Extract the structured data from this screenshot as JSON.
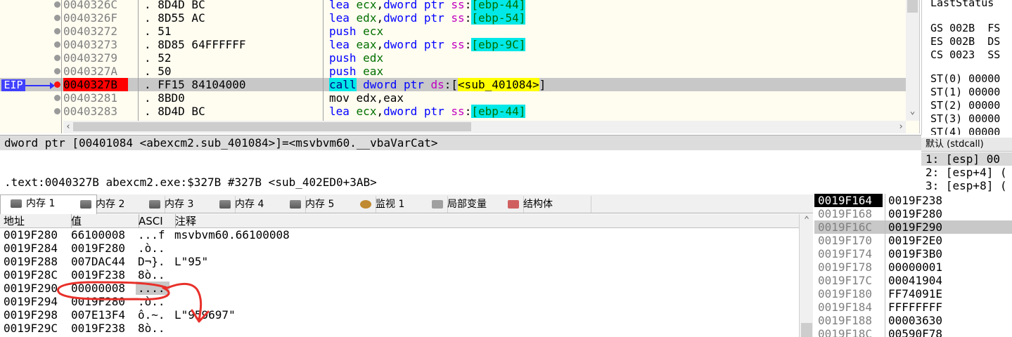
{
  "disasm": {
    "eip_label": "EIP",
    "rows": [
      {
        "addr": "0040326C",
        "bytes": ". 8D4D BC",
        "mn": "lea",
        "ops": [
          [
            "ecx",
            "k-green"
          ],
          [
            ",",
            ""
          ],
          [
            "dword ptr ",
            "k-blue"
          ],
          [
            "ss",
            "k-mag"
          ],
          [
            ":",
            "k-blk"
          ],
          [
            "[ebp-44]",
            "hl-cyan k-green"
          ]
        ]
      },
      {
        "addr": "0040326F",
        "bytes": ". 8D55 AC",
        "mn": "lea",
        "ops": [
          [
            "edx",
            "k-green"
          ],
          [
            ",",
            ""
          ],
          [
            "dword ptr ",
            "k-blue"
          ],
          [
            "ss",
            "k-mag"
          ],
          [
            ":",
            "k-blk"
          ],
          [
            "[ebp-54]",
            "hl-cyan k-green"
          ]
        ]
      },
      {
        "addr": "00403272",
        "bytes": ". 51",
        "mn": "push",
        "ops": [
          [
            "ecx",
            "k-green"
          ]
        ]
      },
      {
        "addr": "00403273",
        "bytes": ". 8D85 64FFFFFF",
        "mn": "lea",
        "ops": [
          [
            "eax",
            "k-green"
          ],
          [
            ",",
            ""
          ],
          [
            "dword ptr ",
            "k-blue"
          ],
          [
            "ss",
            "k-mag"
          ],
          [
            ":",
            "k-blk"
          ],
          [
            "[ebp-9C]",
            "hl-cyan k-green"
          ]
        ]
      },
      {
        "addr": "00403279",
        "bytes": ". 52",
        "mn": "push",
        "ops": [
          [
            "edx",
            "k-green"
          ]
        ]
      },
      {
        "addr": "0040327A",
        "bytes": ". 50",
        "mn": "push",
        "ops": [
          [
            "eax",
            "k-green"
          ]
        ]
      },
      {
        "addr": "0040327B",
        "bytes": ". FF15 84104000",
        "mn": "call",
        "ops": [
          [
            "dword ptr ",
            "k-blue"
          ],
          [
            "ds",
            "k-mag"
          ],
          [
            ":",
            "k-blk"
          ],
          [
            "[",
            "k-blk"
          ],
          [
            "<sub_401084>",
            "hl-yel k-blk"
          ],
          [
            "]",
            "k-blk"
          ]
        ],
        "eip": true
      },
      {
        "addr": "00403281",
        "bytes": ". 8BD0",
        "mn": "mov",
        "ops": [
          [
            "edx",
            "k-blk"
          ],
          [
            ",",
            ""
          ],
          [
            "eax",
            "k-blk"
          ]
        ]
      },
      {
        "addr": "00403283",
        "bytes": ". 8D4D BC",
        "mn": "lea",
        "ops": [
          [
            "ecx",
            "k-green"
          ],
          [
            ",",
            ""
          ],
          [
            "dword ptr ",
            "k-blue"
          ],
          [
            "ss",
            "k-mag"
          ],
          [
            ":",
            "k-blk"
          ],
          [
            "[ebp-44]",
            "hl-cyan k-green"
          ]
        ]
      }
    ]
  },
  "registers": {
    "last_status": "LastStatus",
    "segs": [
      "GS 002B  FS",
      "ES 002B  DS",
      "CS 0023  SS"
    ],
    "st": [
      "ST(0) 00000",
      "ST(1) 00000",
      "ST(2) 00000",
      "ST(3) 00000",
      "ST(4) 00000"
    ]
  },
  "info": {
    "line1": "dword ptr [00401084 <abexcm2.sub_401084>]=<msvbvm60.__vbaVarCat>",
    "line2": ".text:0040327B abexcm2.exe:$327B #327B <sub_402ED0+3AB>"
  },
  "args": {
    "header": "默认 (stdcall)",
    "rows": [
      "1: [esp] 00",
      "2: [esp+4] (",
      "3: [esp+8] ("
    ]
  },
  "tabs": [
    {
      "label": "内存 1",
      "icon": "memory-icon"
    },
    {
      "label": "内存 2",
      "icon": "memory-icon"
    },
    {
      "label": "内存 3",
      "icon": "memory-icon"
    },
    {
      "label": "内存 4",
      "icon": "memory-icon"
    },
    {
      "label": "内存 5",
      "icon": "memory-icon"
    },
    {
      "label": "监视 1",
      "icon": "watch-icon"
    },
    {
      "label": "局部变量",
      "icon": "locals-icon"
    },
    {
      "label": "结构体",
      "icon": "struct-icon"
    }
  ],
  "dump": {
    "headers": [
      "地址",
      "值",
      "ASCI",
      "注释"
    ],
    "rows": [
      [
        "0019F280",
        "66100008",
        "...f",
        "msvbvm60.66100008"
      ],
      [
        "0019F284",
        "0019F280",
        ".ò..",
        ""
      ],
      [
        "0019F288",
        "007DAC44",
        "D¬}.",
        "L\"95\""
      ],
      [
        "0019F28C",
        "0019F238",
        "8ò..",
        ""
      ],
      [
        "0019F290",
        "00000008",
        "....",
        ""
      ],
      [
        "0019F294",
        "0019F280",
        ".ò..",
        ""
      ],
      [
        "0019F298",
        "007E13F4",
        "ô.~.",
        "L\"959697\""
      ],
      [
        "0019F29C",
        "0019F238",
        "8ò..",
        ""
      ]
    ]
  },
  "stack": {
    "rows": [
      [
        "0019F164",
        "0019F238"
      ],
      [
        "0019F168",
        "0019F280"
      ],
      [
        "0019F16C",
        "0019F290"
      ],
      [
        "0019F170",
        "0019F2E0"
      ],
      [
        "0019F174",
        "0019F3B0"
      ],
      [
        "0019F178",
        "00000001"
      ],
      [
        "0019F17C",
        "00041904"
      ],
      [
        "0019F180",
        "FF74091E"
      ],
      [
        "0019F184",
        "FFFFFFFF"
      ],
      [
        "0019F188",
        "00003630"
      ],
      [
        "0019F18C",
        "00590F78"
      ]
    ]
  }
}
